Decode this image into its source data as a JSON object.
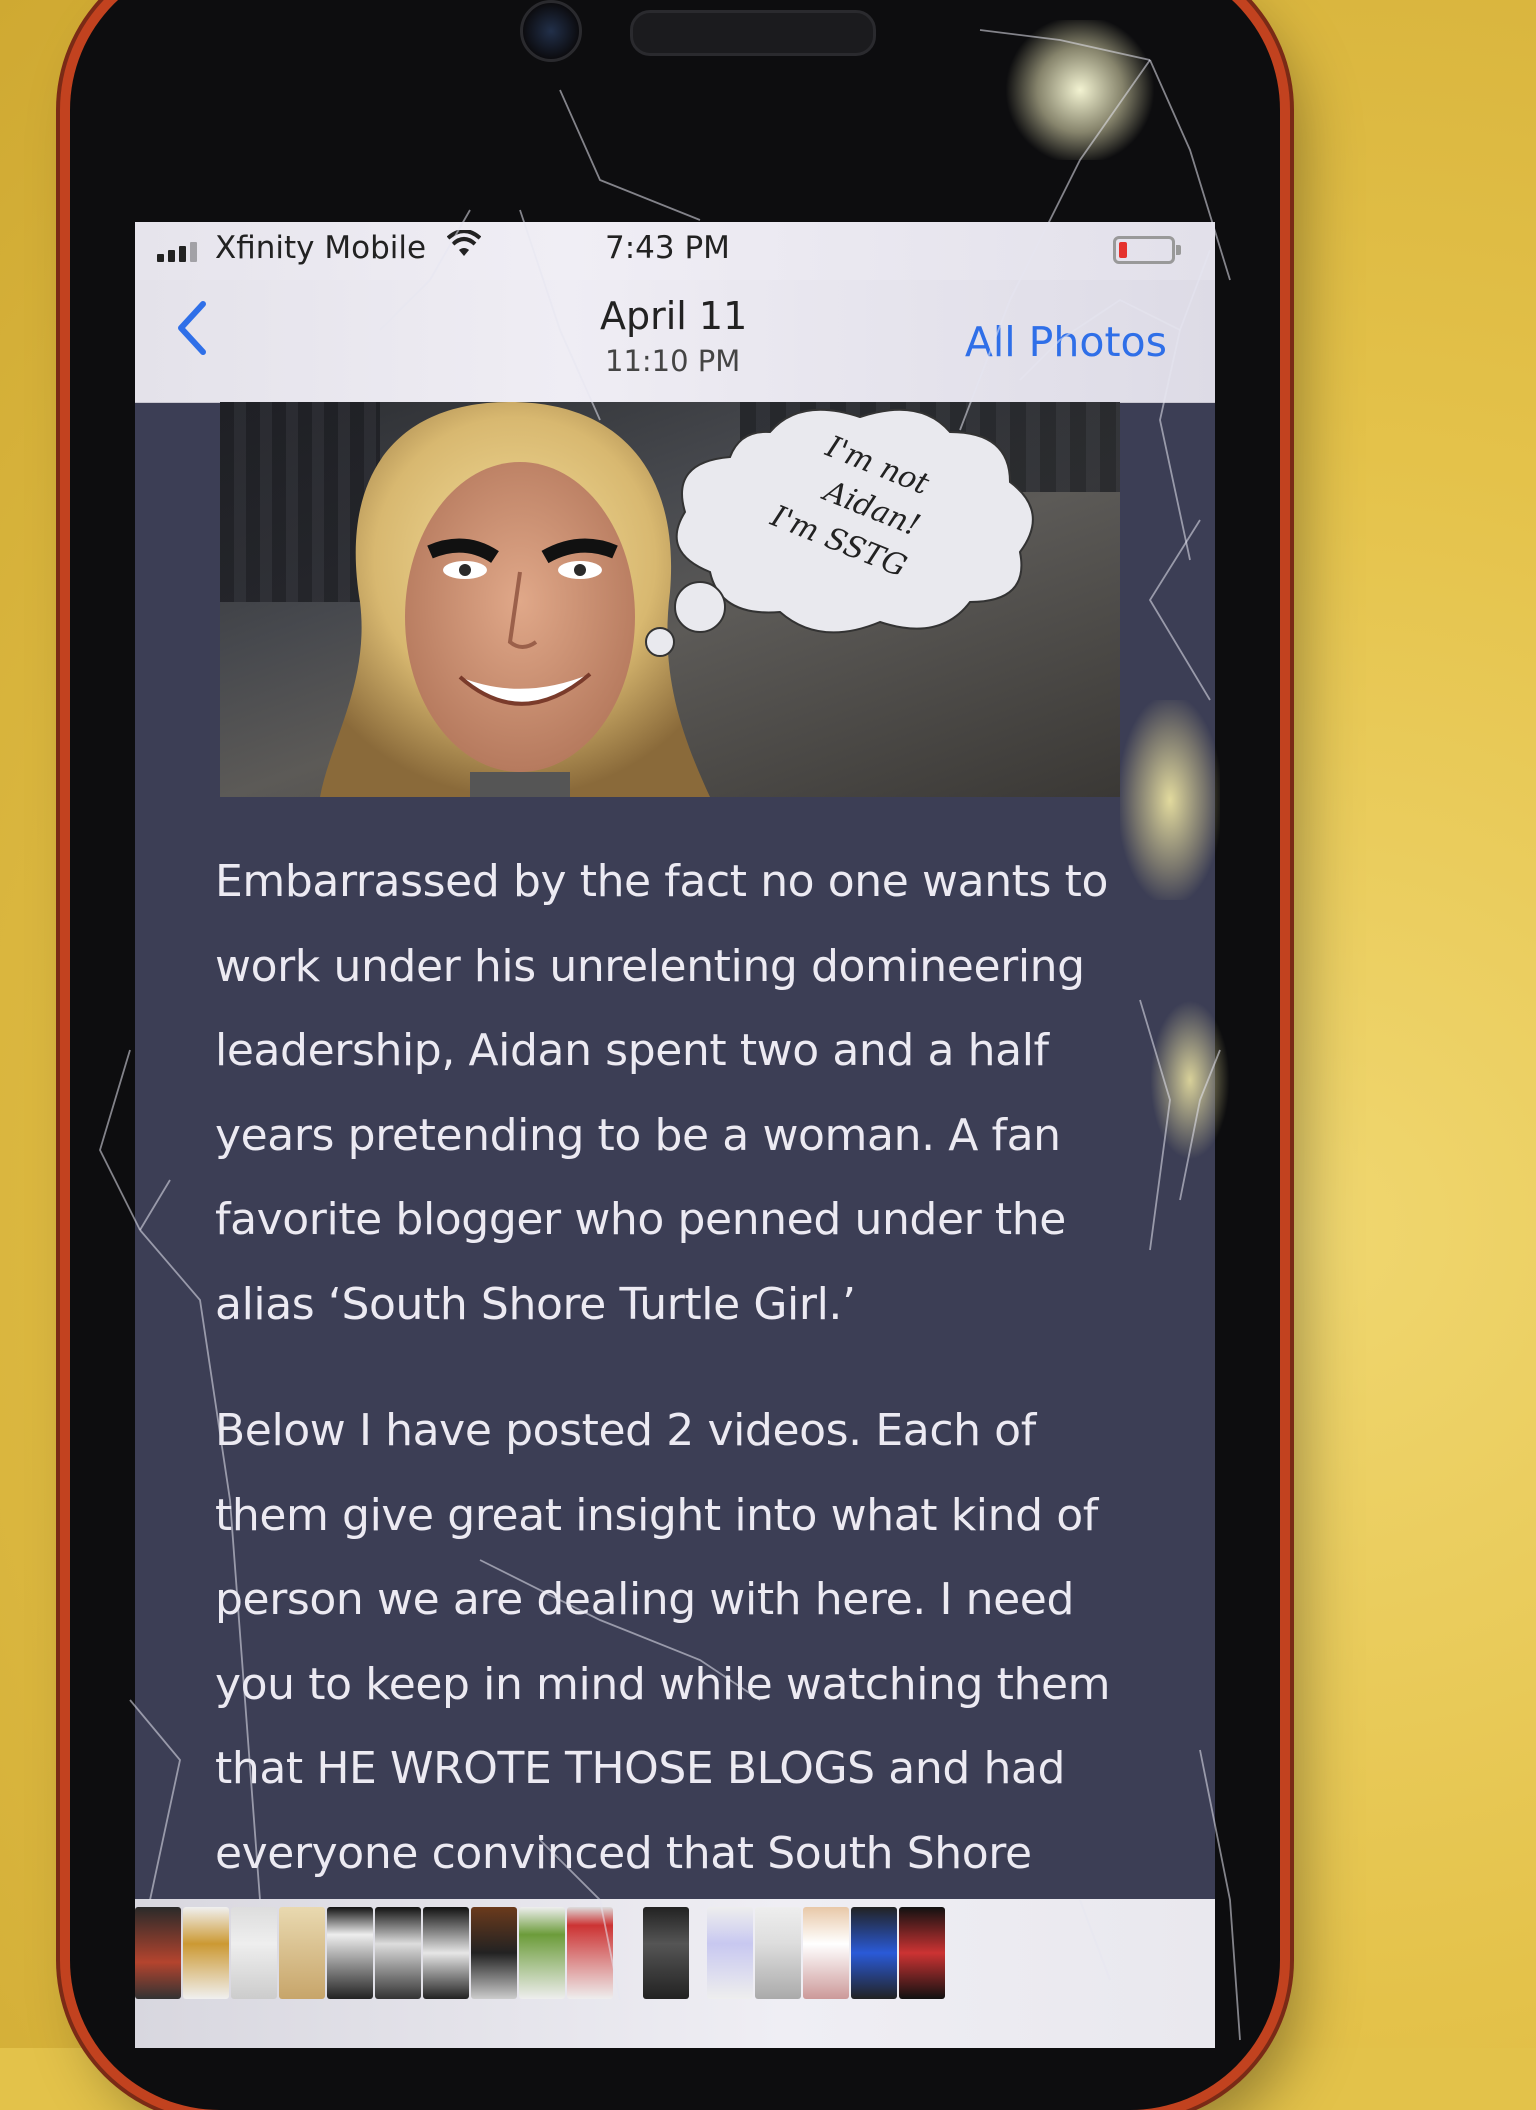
{
  "status_bar": {
    "carrier": "Xfinity Mobile",
    "time": "7:43 PM"
  },
  "nav_bar": {
    "back_icon": "chevron-left-icon",
    "date": "April 11",
    "time": "11:10 PM",
    "all_photos_label": "All Photos"
  },
  "photo": {
    "thought_bubble": {
      "line1": "I'm not",
      "line2": "Aidan!",
      "line3": "I'm SSTG"
    }
  },
  "article": {
    "paragraphs": [
      "Embarrassed by the fact no one wants to work under his unrelenting domineering leadership, Aidan spent two and a half years pretending to be a woman. A fan favorite blogger who penned under the alias ‘South Shore Turtle Girl.’",
      "Below I have posted 2 videos. Each of them give great insight into what kind of person we are dealing with here. I need you to keep in mind while watching them that HE WROTE THOSE BLOGS and had everyone convinced that South Shore"
    ]
  },
  "colors": {
    "accent": "#2f6fe8",
    "screen_background": "#3c3e55",
    "phone_frame": "#c2421f",
    "table_surface": "#e3c24a"
  }
}
